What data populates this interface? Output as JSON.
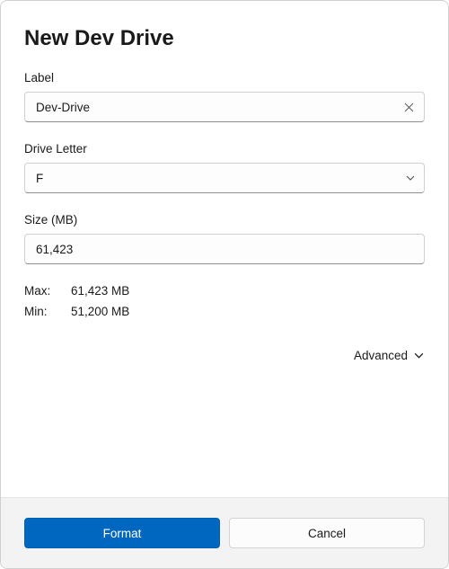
{
  "title": "New Dev Drive",
  "fields": {
    "label": {
      "label": "Label",
      "value": "Dev-Drive"
    },
    "drive_letter": {
      "label": "Drive Letter",
      "value": "F"
    },
    "size": {
      "label": "Size (MB)",
      "value": "61,423"
    }
  },
  "info": {
    "max": {
      "key": "Max:",
      "value": "61,423 MB"
    },
    "min": {
      "key": "Min:",
      "value": "51,200 MB"
    }
  },
  "advanced_label": "Advanced",
  "buttons": {
    "format": "Format",
    "cancel": "Cancel"
  }
}
